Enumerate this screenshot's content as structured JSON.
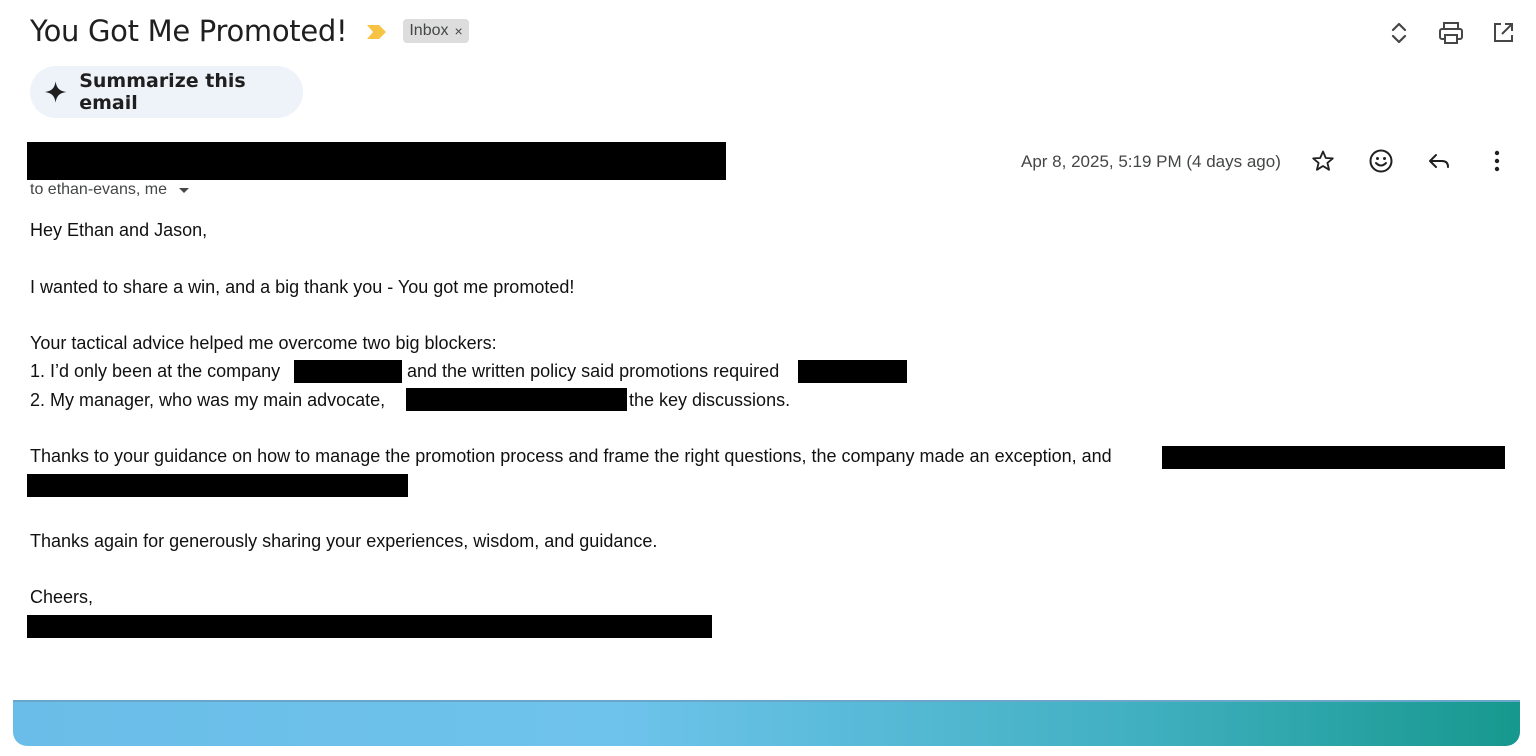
{
  "subject": {
    "title": "You Got Me Promoted!",
    "label": "Inbox",
    "label_remove": "×"
  },
  "top_actions": [
    "expand-collapse-icon",
    "print-icon",
    "open-in-new-window-icon"
  ],
  "summarize": {
    "label": "Summarize this email"
  },
  "message": {
    "recipients": "to ethan-evans, me",
    "date": "Apr 8, 2025, 5:19 PM (4 days ago)",
    "actions": [
      "star-icon",
      "emoji-icon",
      "reply-icon",
      "more-vert-icon"
    ]
  },
  "body": {
    "greeting": "Hey Ethan and Jason,",
    "line1": "I wanted to share a win, and a big thank you - You got me promoted!",
    "line2": "Your tactical advice helped me overcome two big blockers:",
    "item1_a": "1. I’d only been at the company",
    "item1_b": "and the written policy said promotions required",
    "item2_a": "2. My manager, who was my main advocate,",
    "item2_b": "the key discussions.",
    "line3": "Thanks to your guidance on how to manage the promotion process and frame the right questions, the company made an exception, and",
    "line4": "Thanks again for generously sharing your experiences, wisdom, and guidance.",
    "closing": "Cheers,"
  },
  "colors": {
    "importance_marker": "#f6c344",
    "summarize_bg": "#eef2f9",
    "chip_bg": "#dddddd",
    "redaction": "#000000"
  }
}
